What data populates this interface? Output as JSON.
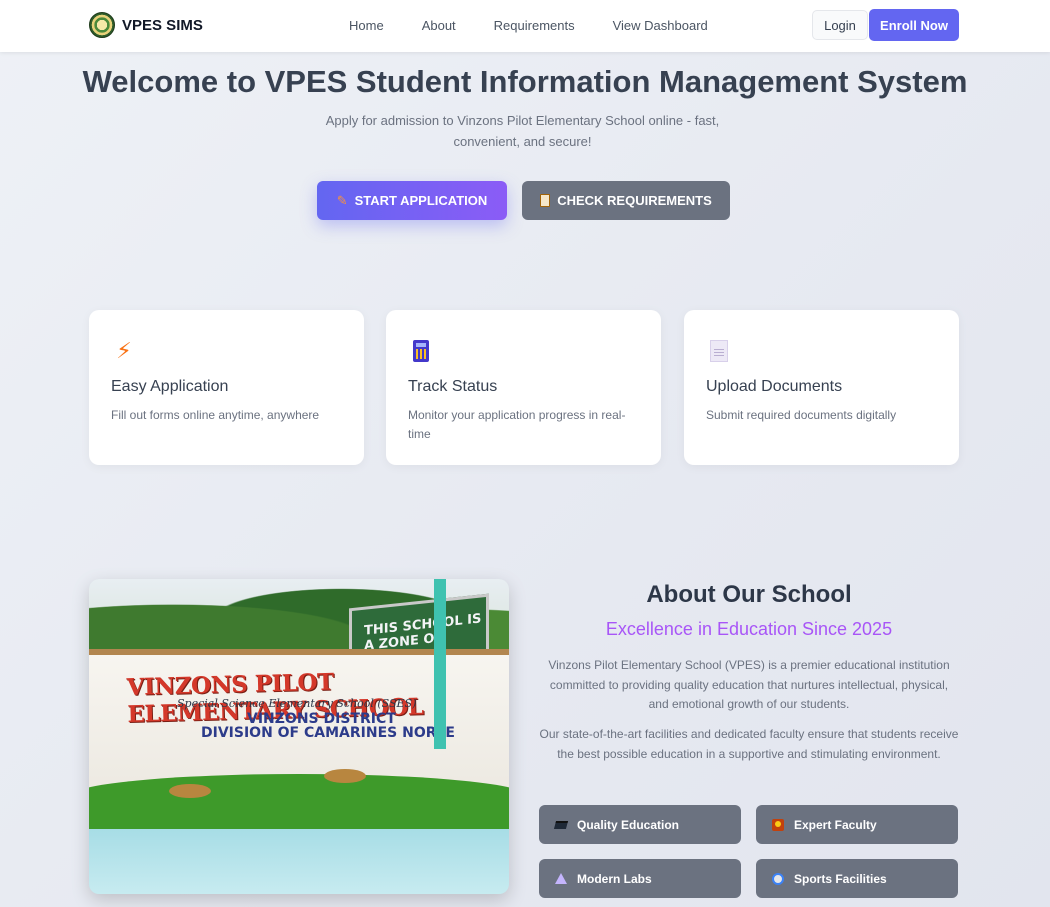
{
  "nav": {
    "brand": "VPES SIMS",
    "links": [
      "Home",
      "About",
      "Requirements",
      "View Dashboard"
    ],
    "login": "Login",
    "enroll": "Enroll Now"
  },
  "hero": {
    "title": "Welcome to VPES Student Information Management System",
    "subtitle": "Apply for admission to Vinzons Pilot Elementary School online - fast, convenient, and secure!",
    "start_button": "START APPLICATION",
    "check_button": "CHECK REQUIREMENTS"
  },
  "features": [
    {
      "icon": "lightning-icon",
      "title": "Easy Application",
      "desc": "Fill out forms online anytime, anywhere"
    },
    {
      "icon": "calculator-icon",
      "title": "Track Status",
      "desc": "Monitor your application progress in real-time"
    },
    {
      "icon": "document-icon",
      "title": "Upload Documents",
      "desc": "Submit required documents digitally"
    }
  ],
  "photo": {
    "sign": "THIS SCHOOL IS A ZONE OF PEACE",
    "wall_title": "VINZONS PILOT ELEMENTARY SCHOOL",
    "wall_subtitle": "Special Science Elementary School (SSES)",
    "wall_district": "VINZONS DISTRICT",
    "wall_division": "DIVISION OF CAMARINES NORTE"
  },
  "about": {
    "title": "About Our School",
    "subtitle": "Excellence in Education Since 2025",
    "p1": "Vinzons Pilot Elementary School (VPES) is a premier educational institution committed to providing quality education that nurtures intellectual, physical, and emotional growth of our students.",
    "p2": "Our state-of-the-art facilities and dedicated faculty ensure that students receive the best possible education in a supportive and stimulating environment.",
    "highlights": [
      {
        "icon": "graduation-cap-icon",
        "label": "Quality Education"
      },
      {
        "icon": "teacher-icon",
        "label": "Expert Faculty"
      },
      {
        "icon": "flask-icon",
        "label": "Modern Labs"
      },
      {
        "icon": "ball-icon",
        "label": "Sports Facilities"
      }
    ]
  },
  "colors": {
    "primary": "#6366f1",
    "secondary": "#6b7280",
    "accent_purple": "#a855f7"
  }
}
